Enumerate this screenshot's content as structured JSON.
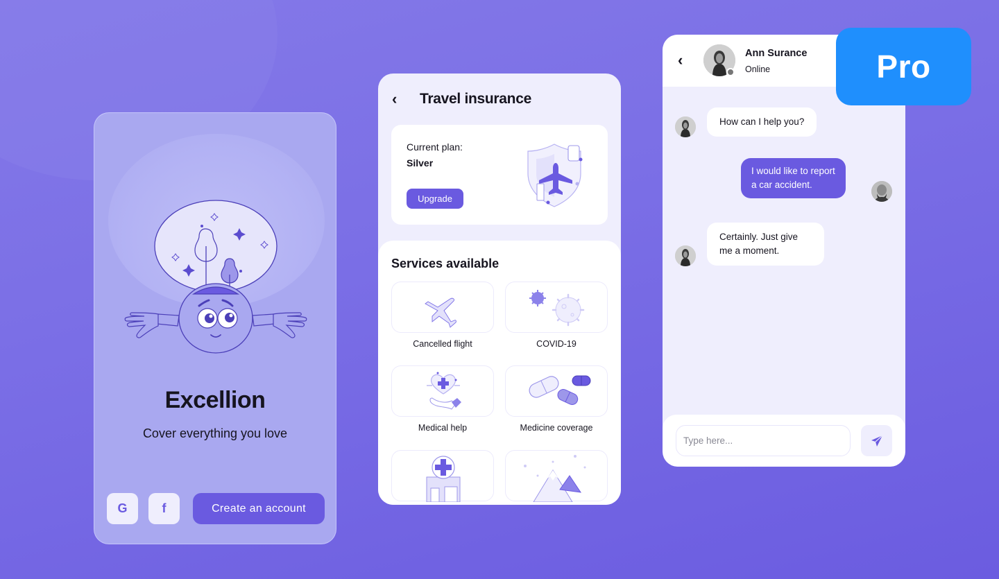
{
  "colors": {
    "accent": "#6a5ae0",
    "background_top": "#8479e8",
    "background_bottom": "#6b5ce0",
    "card_light": "#efeefd",
    "pro_badge": "#1f8ffd",
    "text_dark": "#16141f"
  },
  "onboarding": {
    "brand": "Excellion",
    "tagline": "Cover everything you love",
    "illustration": "mascot-dreaming-icon",
    "social_buttons": [
      {
        "label": "G",
        "icon": "google-icon"
      },
      {
        "label": "f",
        "icon": "facebook-icon"
      }
    ],
    "create_account_label": "Create an account"
  },
  "travel": {
    "back_icon": "chevron-left-icon",
    "title": "Travel insurance",
    "plan_label": "Current plan:",
    "plan_value": "Silver",
    "upgrade_label": "Upgrade",
    "plan_illustration": "shield-airplane-icon",
    "services_heading": "Services available",
    "services": [
      {
        "label": "Cancelled flight",
        "icon": "airplane-icon"
      },
      {
        "label": "COVID-19",
        "icon": "virus-icon"
      },
      {
        "label": "Medical help",
        "icon": "heart-hand-icon"
      },
      {
        "label": "Medicine coverage",
        "icon": "pills-icon"
      },
      {
        "label": "",
        "icon": "hospital-icon"
      },
      {
        "label": "",
        "icon": "mountains-icon"
      }
    ]
  },
  "chat": {
    "back_icon": "chevron-left-icon",
    "contact_name": "Ann Surance",
    "contact_status": "Online",
    "messages": [
      {
        "direction": "in",
        "lines": [
          "How can I help you?"
        ]
      },
      {
        "direction": "out",
        "lines": [
          "I would like to report",
          "a car accident."
        ]
      },
      {
        "direction": "in",
        "lines": [
          "Certainly. Just give",
          "me a moment."
        ]
      }
    ],
    "input_placeholder": "Type here...",
    "send_icon": "send-icon"
  },
  "badge": {
    "label": "Pro"
  }
}
